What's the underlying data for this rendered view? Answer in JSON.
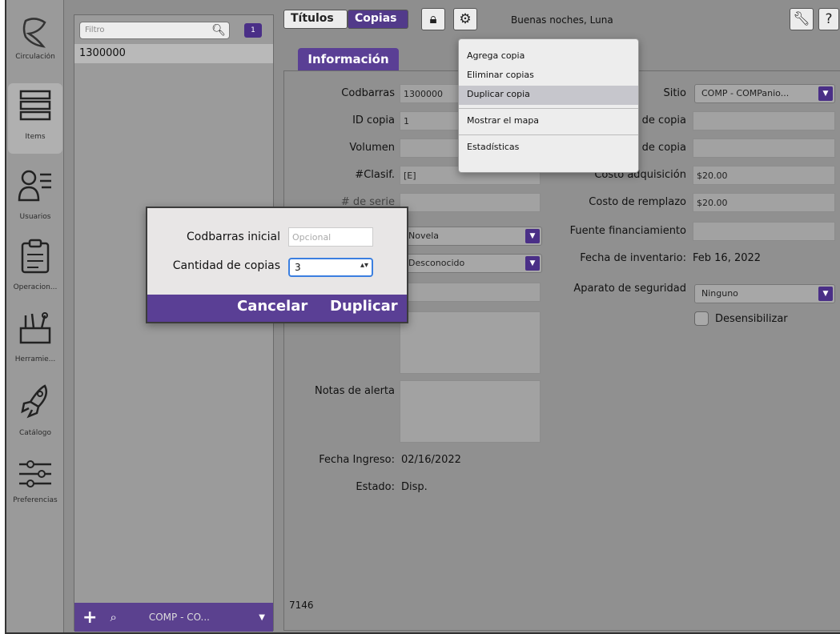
{
  "nav": {
    "items": [
      {
        "label": "Circulación",
        "icon": "circulation-icon"
      },
      {
        "label": "Ítems",
        "icon": "books-icon"
      },
      {
        "label": "Usuarios",
        "icon": "users-icon"
      },
      {
        "label": "Operacion...",
        "icon": "clipboard-icon"
      },
      {
        "label": "Herramie...",
        "icon": "tools-icon"
      },
      {
        "label": "Catálogo",
        "icon": "rocket-icon"
      },
      {
        "label": "Preferencias",
        "icon": "sliders-icon"
      }
    ]
  },
  "list": {
    "filter_placeholder": "Filtro",
    "count": "1",
    "rows": [
      "1300000"
    ],
    "footer_site": "COMP - CO..."
  },
  "topbar": {
    "tab_titles": "Títulos",
    "tab_copies": "Copias",
    "greeting": "Buenas noches, Luna"
  },
  "menu": {
    "items": [
      "Agrega copia",
      "Eliminar copias",
      "Duplicar copia",
      "Mostrar el mapa",
      "Estadísticas"
    ],
    "highlighted": "Duplicar copia"
  },
  "info_tab": "Información",
  "form_left": {
    "barcode_label": "Codbarras",
    "barcode_value": "1300000",
    "copy_id_label": "ID copia",
    "copy_id_value": "1",
    "volume_label": "Volumen",
    "callnum_label": "#Clasif.",
    "callnum_value": "[E]",
    "serial_label": "# de serie",
    "type_value": "Novela",
    "status_select_value": "Desconocido",
    "alert_notes_label": "Notas de alerta",
    "entry_date_label": "Fecha Ingreso:",
    "entry_date_value": "02/16/2022",
    "state_label": "Estado:",
    "state_value": "Disp.",
    "footer_number": "7146"
  },
  "form_right": {
    "site_label": "Sitio",
    "site_value": "COMP - COMPanio...",
    "copy_field2_label": "de copia",
    "copy_field3_label": "de copia",
    "acq_cost_label": "Costo adquisición",
    "acq_cost_value": "$20.00",
    "repl_cost_label": "Costo de remplazo",
    "repl_cost_value": "$20.00",
    "funding_label": "Fuente financiamiento",
    "inventory_label": "Fecha de inventario:",
    "inventory_value": "Feb 16, 2022",
    "security_label": "Aparato de seguridad",
    "security_value": "Ninguno",
    "desensitize_label": "Desensibilizar"
  },
  "dialog": {
    "start_barcode_label": "Codbarras inicial",
    "start_barcode_placeholder": "Opcional",
    "count_label": "Cantidad de copias",
    "count_value": "3",
    "cancel_label": "Cancelar",
    "duplicate_label": "Duplicar"
  },
  "colors": {
    "accent": "#5a3f95",
    "background": "#8e8e8e"
  }
}
